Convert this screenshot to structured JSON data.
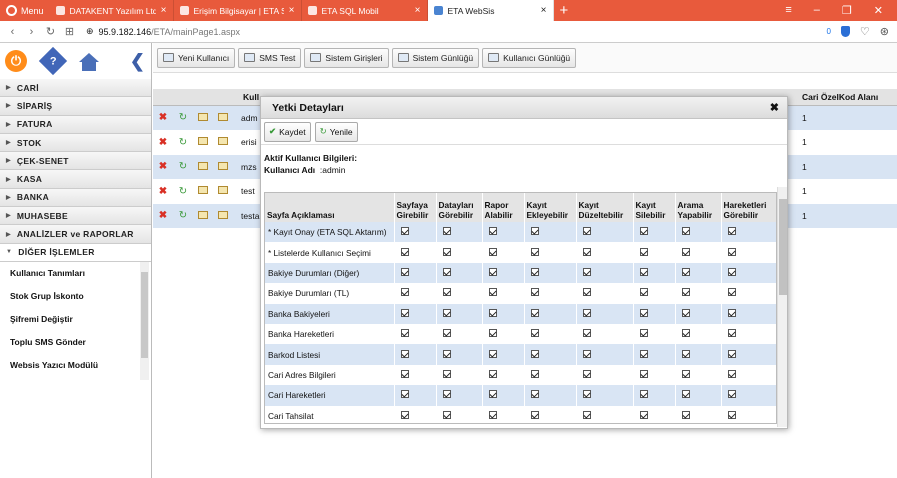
{
  "browser": {
    "menu_label": "Menu",
    "tabs": [
      {
        "title": "DATAKENT Yazılım Ltd. Şti.",
        "active": false
      },
      {
        "title": "Erişim Bilgisayar | ETA SQL",
        "active": false
      },
      {
        "title": "ETA SQL Mobil",
        "active": false
      },
      {
        "title": "ETA WebSis",
        "active": true
      }
    ],
    "url_host": "95.9.182.146",
    "url_path": "/ETA/mainPage1.aspx",
    "badge_count": "0"
  },
  "sidebar": {
    "menu": [
      "CARİ",
      "SİPARİŞ",
      "FATURA",
      "STOK",
      "ÇEK-SENET",
      "KASA",
      "BANKA",
      "MUHASEBE",
      "ANALİZLER ve RAPORLAR"
    ],
    "open_section": "DİĞER İŞLEMLER",
    "sub_items": [
      "Kullanıcı Tanımları",
      "Stok Grup İskonto",
      "Şifremi Değiştir",
      "Toplu SMS Gönder",
      "Websis Yazıcı Modülü"
    ]
  },
  "toolbar": {
    "buttons": [
      "Yeni Kullanıcı",
      "SMS Test",
      "Sistem Girişleri",
      "Sistem Günlüğü",
      "Kullanıcı Günlüğü"
    ]
  },
  "grid": {
    "col_user": "Kull",
    "col_cari": "Cari ÖzelKod Alanı",
    "rows": [
      {
        "user": "adm",
        "cari": "1"
      },
      {
        "user": "erisi",
        "cari": "1"
      },
      {
        "user": "mzs",
        "cari": "1"
      },
      {
        "user": "test",
        "cari": "1"
      },
      {
        "user": "testa",
        "cari": "1"
      }
    ]
  },
  "dialog": {
    "title": "Yetki Detayları",
    "close": "✖",
    "save_label": "Kaydet",
    "refresh_label": "Yenile",
    "info_heading": "Aktif Kullanıcı Bilgileri:",
    "user_label": "Kullanıcı Adı",
    "user_value": ":admin",
    "headers": [
      "Sayfa Açıklaması",
      "Sayfaya Girebilir",
      "Datayları Görebilir",
      "Rapor Alabilir",
      "Kayıt Ekleyebilir",
      "Kayıt Düzeltebilir",
      "Kayıt Silebilir",
      "Arama Yapabilir",
      "Hareketleri Görebilir"
    ],
    "rows": [
      "* Kayıt Onay (ETA SQL Aktarım)",
      "* Listelerde Kullanıcı Seçimi",
      "Bakiye Durumları (Diğer)",
      "Bakiye Durumları (TL)",
      "Banka Bakiyeleri",
      "Banka Hareketleri",
      "Barkod Listesi",
      "Cari Adres Bilgileri",
      "Cari Hareketleri",
      "Cari Tahsilat"
    ]
  }
}
